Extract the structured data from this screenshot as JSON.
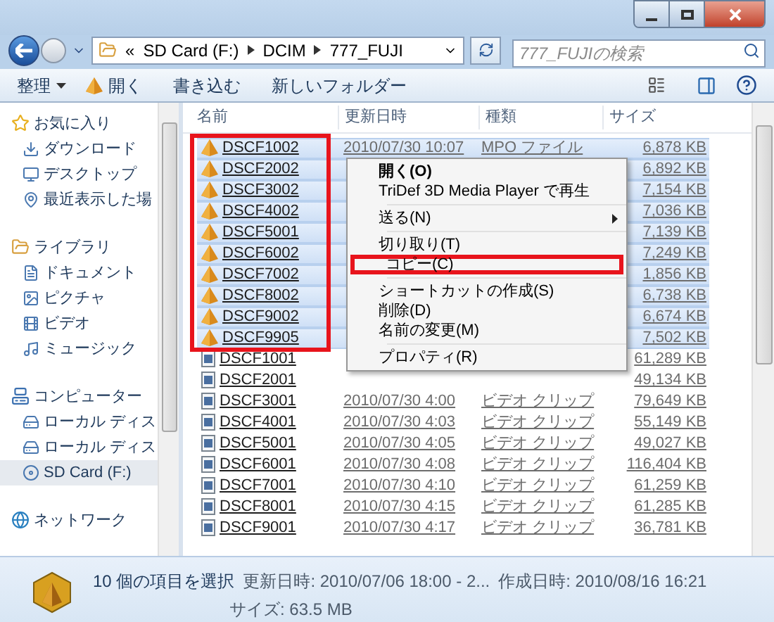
{
  "address": {
    "prefix": "«",
    "crumbs": [
      "SD Card (F:)",
      "DCIM",
      "777_FUJI"
    ]
  },
  "search": {
    "placeholder": "777_FUJIの検索"
  },
  "toolbar": [
    {
      "label": "整理",
      "kind": "dropdown"
    },
    {
      "label": "開く",
      "kind": "icon"
    },
    {
      "label": "書き込む",
      "kind": "plain"
    },
    {
      "label": "新しいフォルダー",
      "kind": "plain"
    }
  ],
  "sidebar": {
    "groups": [
      {
        "label": "お気に入り",
        "selected": false,
        "children": [
          {
            "label": "ダウンロード",
            "selected": false
          },
          {
            "label": "デスクトップ",
            "selected": false
          },
          {
            "label": "最近表示した場",
            "selected": false
          }
        ]
      },
      {
        "label": "ライブラリ",
        "selected": false,
        "children": [
          {
            "label": "ドキュメント",
            "selected": false
          },
          {
            "label": "ピクチャ",
            "selected": false
          },
          {
            "label": "ビデオ",
            "selected": false
          },
          {
            "label": "ミュージック",
            "selected": false
          }
        ]
      },
      {
        "label": "コンピューター",
        "selected": false,
        "children": [
          {
            "label": "ローカル ディス",
            "selected": false
          },
          {
            "label": "ローカル ディス",
            "selected": false
          },
          {
            "label": "SD Card (F:)",
            "selected": true
          }
        ]
      },
      {
        "label": "ネットワーク",
        "selected": false
      }
    ]
  },
  "table": {
    "columns": [
      "名前",
      "更新日時",
      "種類",
      "サイズ"
    ],
    "rows": [
      {
        "kind": "mpo",
        "selected": true,
        "name": "DSCF1002",
        "date": "2010/07/30 10:07",
        "type": "MPO ファイル",
        "size": "6,878 KB"
      },
      {
        "kind": "mpo",
        "selected": true,
        "name": "DSCF2002",
        "size": "6,892 KB"
      },
      {
        "kind": "mpo",
        "selected": true,
        "name": "DSCF3002",
        "size": "7,154 KB"
      },
      {
        "kind": "mpo",
        "selected": true,
        "name": "DSCF4002",
        "size": "7,036 KB"
      },
      {
        "kind": "mpo",
        "selected": true,
        "name": "DSCF5001",
        "size": "7,139 KB"
      },
      {
        "kind": "mpo",
        "selected": true,
        "name": "DSCF6002",
        "size": "7,249 KB"
      },
      {
        "kind": "mpo",
        "selected": true,
        "name": "DSCF7002",
        "size": "1,856 KB"
      },
      {
        "kind": "mpo",
        "selected": true,
        "name": "DSCF8002",
        "size": "6,738 KB"
      },
      {
        "kind": "mpo",
        "selected": true,
        "name": "DSCF9002",
        "size": "6,674 KB"
      },
      {
        "kind": "mpo",
        "selected": true,
        "name": "DSCF9905",
        "size": "7,502 KB"
      },
      {
        "kind": "video",
        "selected": false,
        "name": "DSCF1001",
        "size": "61,289 KB"
      },
      {
        "kind": "video",
        "selected": false,
        "name": "DSCF2001",
        "size": "49,134 KB"
      },
      {
        "kind": "video",
        "selected": false,
        "name": "DSCF3001",
        "date": "2010/07/30 4:00",
        "type": "ビデオ クリップ",
        "size": "79,649 KB"
      },
      {
        "kind": "video",
        "selected": false,
        "name": "DSCF4001",
        "date": "2010/07/30 4:03",
        "type": "ビデオ クリップ",
        "size": "55,149 KB"
      },
      {
        "kind": "video",
        "selected": false,
        "name": "DSCF5001",
        "date": "2010/07/30 4:05",
        "type": "ビデオ クリップ",
        "size": "49,027 KB"
      },
      {
        "kind": "video",
        "selected": false,
        "name": "DSCF6001",
        "date": "2010/07/30 4:08",
        "type": "ビデオ クリップ",
        "size": "116,404 KB"
      },
      {
        "kind": "video",
        "selected": false,
        "name": "DSCF7001",
        "date": "2010/07/30 4:10",
        "type": "ビデオ クリップ",
        "size": "61,259 KB"
      },
      {
        "kind": "video",
        "selected": false,
        "name": "DSCF8001",
        "date": "2010/07/30 4:15",
        "type": "ビデオ クリップ",
        "size": "61,285 KB"
      },
      {
        "kind": "video",
        "selected": false,
        "name": "DSCF9001",
        "date": "2010/07/30 4:17",
        "type": "ビデオ クリップ",
        "size": "36,781 KB"
      }
    ]
  },
  "context_menu": [
    {
      "kind": "item",
      "label": "開く(O)",
      "bold": true,
      "highlighted": false
    },
    {
      "kind": "item",
      "label": "TriDef 3D Media Player で再生",
      "bold": false,
      "highlighted": false
    },
    {
      "kind": "separator"
    },
    {
      "kind": "submenu",
      "label": "送る(N)",
      "bold": false,
      "highlighted": false
    },
    {
      "kind": "separator"
    },
    {
      "kind": "item",
      "label": "切り取り(T)",
      "bold": false,
      "highlighted": false
    },
    {
      "kind": "item",
      "label": "コピー(C)",
      "bold": false,
      "highlighted": true
    },
    {
      "kind": "separator"
    },
    {
      "kind": "item",
      "label": "ショートカットの作成(S)",
      "bold": false,
      "highlighted": false
    },
    {
      "kind": "item",
      "label": "削除(D)",
      "bold": false,
      "highlighted": false
    },
    {
      "kind": "item",
      "label": "名前の変更(M)",
      "bold": false,
      "highlighted": false
    },
    {
      "kind": "separator"
    },
    {
      "kind": "item",
      "label": "プロパティ(R)",
      "bold": false,
      "highlighted": false
    }
  ],
  "status_bar": {
    "selection": "10 個の項目を選択",
    "modified": "更新日時: 2010/07/06 18:00 - 2...",
    "created": "作成日時: 2010/08/16 16:21",
    "size": "サイズ: 63.5 MB"
  }
}
